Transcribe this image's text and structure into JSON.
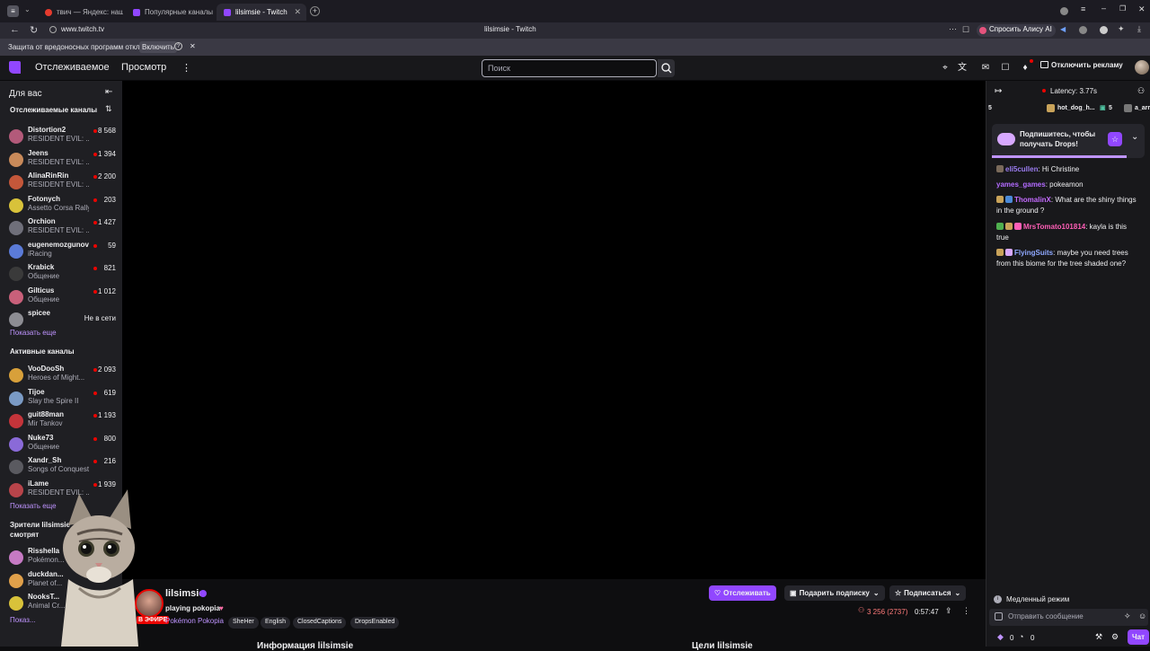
{
  "browser": {
    "tabs": [
      {
        "label": "твич — Яндекс: нашлось"
      },
      {
        "label": "Популярные каналы - Tw"
      },
      {
        "label": "lilsimsie - Twitch"
      }
    ],
    "url": "www.twitch.tv",
    "page_title": "lilsimsie - Twitch",
    "alice_label": "Спросить Алису AI",
    "infobar_text": "Защита от вредоносных программ отключена",
    "infobar_button": "Включить"
  },
  "header": {
    "following": "Отслеживаемое",
    "browse": "Просмотр",
    "search_placeholder": "Поиск",
    "adfree": "Отключить рекламу"
  },
  "sidebar": {
    "for_you": "Для вас",
    "followed_title": "Отслеживаемые каналы",
    "followed": [
      {
        "name": "Distortion2",
        "game": "RESIDENT EVIL: ...",
        "viewers": "8 568"
      },
      {
        "name": "Jeens",
        "game": "RESIDENT EVIL: ...",
        "viewers": "1 394"
      },
      {
        "name": "AlinaRinRin",
        "game": "RESIDENT EVIL: ...",
        "viewers": "2 200"
      },
      {
        "name": "Fotonych",
        "game": "Assetto Corsa Rally",
        "viewers": "203"
      },
      {
        "name": "Orchion",
        "game": "RESIDENT EVIL: ...",
        "viewers": "1 427"
      },
      {
        "name": "eugenemozgunov",
        "game": "iRacing",
        "viewers": "59"
      },
      {
        "name": "Krabick",
        "game": "Общение",
        "viewers": "821"
      },
      {
        "name": "Gilticus",
        "game": "Общение",
        "viewers": "1 012"
      },
      {
        "name": "spicee",
        "game": "",
        "viewers": "Не в сети"
      }
    ],
    "show_more": "Показать еще",
    "active_title": "Активные каналы",
    "active": [
      {
        "name": "VooDooSh",
        "game": "Heroes of Might...",
        "viewers": "2 093"
      },
      {
        "name": "Tijoe",
        "game": "Slay the Spire II",
        "viewers": "619"
      },
      {
        "name": "guit88man",
        "game": "Mir Tankov",
        "viewers": "1 193"
      },
      {
        "name": "Nuke73",
        "game": "Общение",
        "viewers": "800"
      },
      {
        "name": "Xandr_Sh",
        "game": "Songs of Conquest",
        "viewers": "216"
      },
      {
        "name": "iLame",
        "game": "RESIDENT EVIL: ...",
        "viewers": "1 939"
      }
    ],
    "show_more_2": "Показать еще",
    "viewers_also_line1": "Зрители lilsimsie",
    "viewers_also_line2": "смотрят",
    "also": [
      {
        "name": "Risshella",
        "game": "Pokémon..."
      },
      {
        "name": "duckdan...",
        "game": "Planet of..."
      },
      {
        "name": "NooksT...",
        "game": "Animal Cr..."
      }
    ],
    "show_more_3": "Показ..."
  },
  "stream": {
    "channel": "lilsimsie",
    "title": "playing pokopia",
    "live_badge": "В ЭФИРЕ",
    "game": "Pokémon Pokopia",
    "tags": [
      "SheHer",
      "English",
      "ClosedCaptions",
      "DropsEnabled"
    ],
    "follow": "Отслеживать",
    "gift": "Подарить подписку",
    "subscribe": "Подписаться",
    "viewers": "3 256 (2737)",
    "uptime": "0:57:47",
    "about_peek": "Информация lilsimsie",
    "goals_peek": "Цели lilsimsie"
  },
  "chat": {
    "latency": "Latency: 3.77s",
    "gift_count_1": "5",
    "gift_user": "hot_dog_h...",
    "gift_count_2": "5",
    "gift_user_2": "a_arr",
    "drops_text_line1": "Подпишитесь, чтобы",
    "drops_text_line2": "получать Drops!",
    "messages": [
      {
        "user": "eli5cullen",
        "color": "#9b7cf0",
        "text": ": Hi Christine"
      },
      {
        "user": "yames_games",
        "color": "#b36bff",
        "text": ": pokeamon"
      },
      {
        "user": "ThomalinX",
        "color": "#c46bff",
        "text": ": What are the shiny things in the ground ?"
      },
      {
        "user": "MrsTomato101814",
        "color": "#ff5fb7",
        "text": ": kayla is this true"
      },
      {
        "user": "FlyingSuits",
        "color": "#8fa8ff",
        "text": ": maybe you need trees from this biome for the tree shaded one?"
      }
    ],
    "slow_mode": "Медленный режим",
    "send_placeholder": "Отправить сообщение",
    "points_1": "0",
    "points_2": "0",
    "chat_button": "Чат"
  },
  "colors": {
    "accent": "#9147ff",
    "live": "#eb0400",
    "sidebar": "#1f1f23"
  }
}
